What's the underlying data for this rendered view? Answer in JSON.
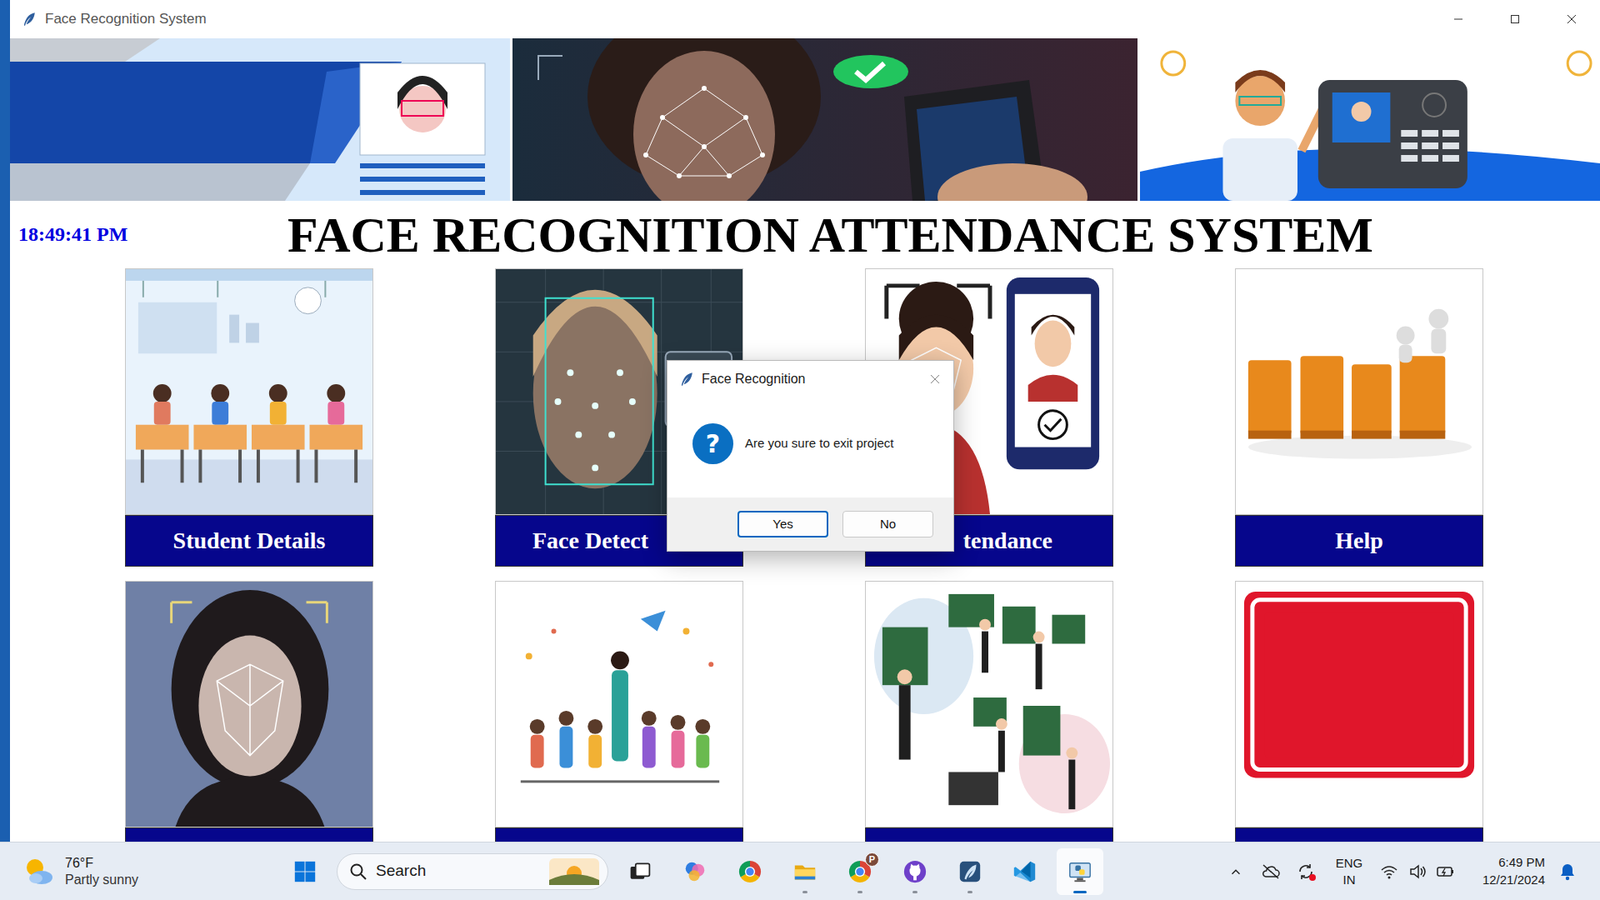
{
  "window": {
    "title": "Face Recognition System"
  },
  "clock": "18:49:41 PM",
  "heading": "FACE RECOGNITION ATTENDANCE SYSTEM",
  "tiles": [
    {
      "label": "Student Details"
    },
    {
      "label": "Face Detect"
    },
    {
      "label": "tendance"
    },
    {
      "label": "Help"
    }
  ],
  "dialog": {
    "title": "Face Recognition",
    "icon": "?",
    "message": "Are you sure to exit project",
    "buttons": [
      {
        "label": "Yes",
        "focused": true
      },
      {
        "label": "No",
        "focused": false
      }
    ]
  },
  "taskbar": {
    "weather": {
      "temp": "76°F",
      "text": "Partly sunny"
    },
    "search": {
      "label": "Search"
    },
    "apps": [
      {
        "kind": "task-view",
        "running": false,
        "active": false
      },
      {
        "kind": "copilot",
        "running": false,
        "active": false
      },
      {
        "kind": "chrome",
        "running": false,
        "active": false
      },
      {
        "kind": "explorer",
        "running": true,
        "active": false
      },
      {
        "kind": "chrome-profile",
        "running": true,
        "active": false,
        "badge": "P"
      },
      {
        "kind": "github",
        "running": true,
        "active": false
      },
      {
        "kind": "app",
        "running": true,
        "active": false
      },
      {
        "kind": "vscode",
        "running": false,
        "active": false
      },
      {
        "kind": "python",
        "running": true,
        "active": true
      }
    ],
    "tray": {
      "sync_alert": true,
      "language": "ENG",
      "region": "IN",
      "time": "6:49 PM",
      "date": "12/21/2024"
    }
  }
}
